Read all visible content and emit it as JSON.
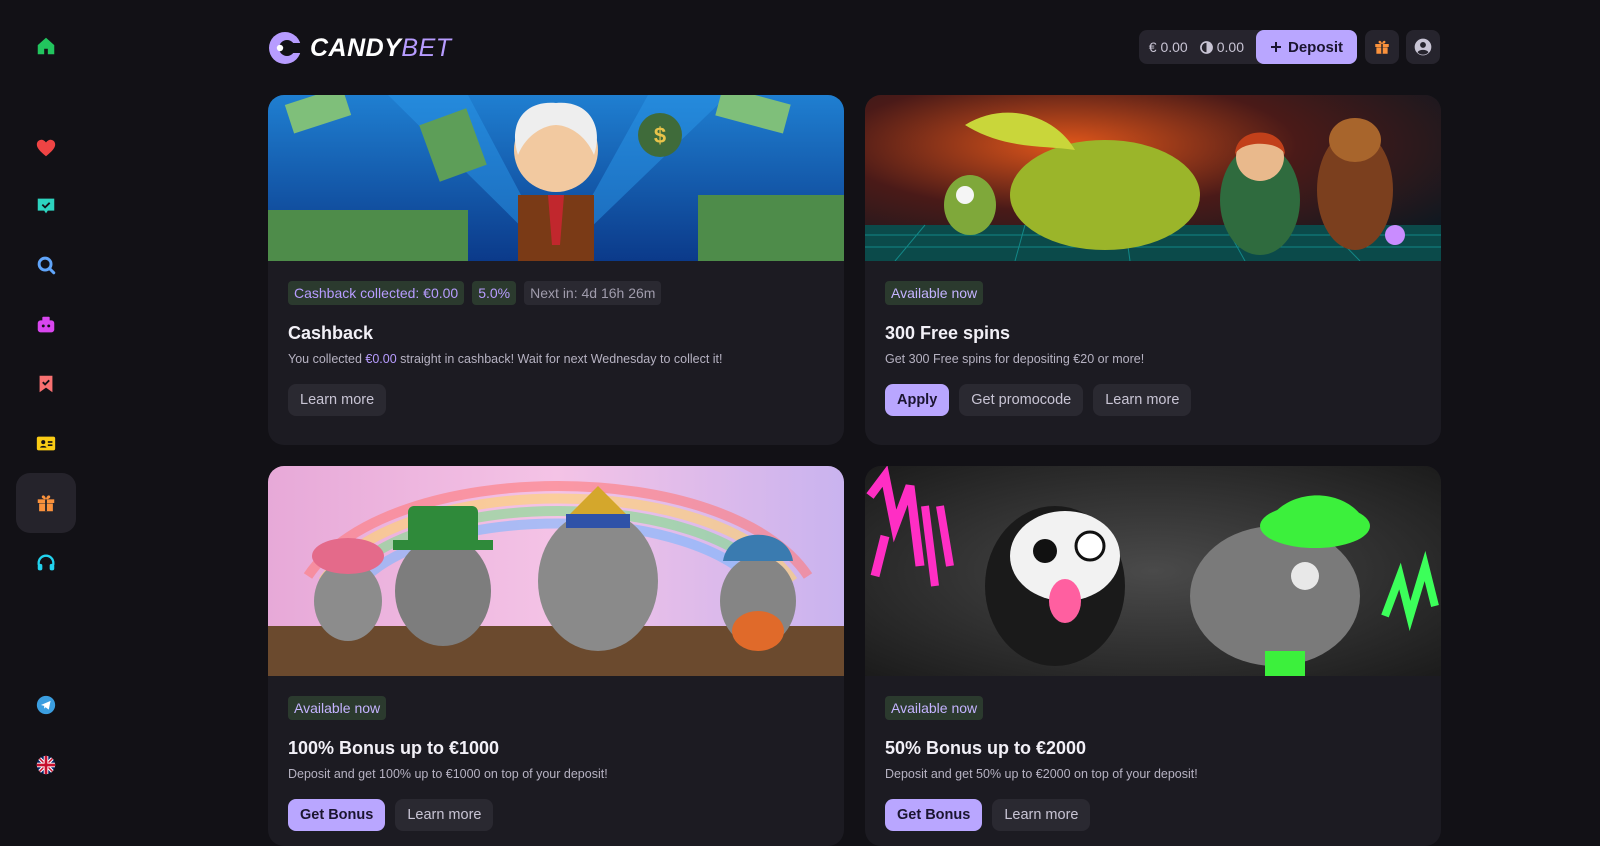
{
  "brand": {
    "name_part1": "CANDY",
    "name_part2": "BET"
  },
  "wallet": {
    "euro_balance": "€ 0.00",
    "bonus_balance": "0.00",
    "deposit_label": "Deposit"
  },
  "sidebar": {
    "items": [
      {
        "name": "home",
        "icon": "home-icon",
        "color": "#22c55e"
      },
      {
        "name": "favorites",
        "icon": "heart-icon",
        "color": "#ef4444"
      },
      {
        "name": "tasks",
        "icon": "chat-check-icon",
        "color": "#2dd4bf"
      },
      {
        "name": "search",
        "icon": "search-icon",
        "color": "#60a5fa"
      },
      {
        "name": "games",
        "icon": "gamepad-icon",
        "color": "#d946ef"
      },
      {
        "name": "bookmarks",
        "icon": "bookmark-check-icon",
        "color": "#f87171"
      },
      {
        "name": "profile-card",
        "icon": "id-card-icon",
        "color": "#facc15"
      },
      {
        "name": "promotions",
        "icon": "gift-icon",
        "color": "#fb923c"
      },
      {
        "name": "support",
        "icon": "headset-icon",
        "color": "#22d3ee"
      },
      {
        "name": "telegram",
        "icon": "telegram-icon",
        "color": "#3b9ee0"
      },
      {
        "name": "language",
        "icon": "uk-flag-icon",
        "color": "#c8102e"
      }
    ]
  },
  "promos": [
    {
      "badges": [
        "Cashback collected: €0.00",
        "5.0%",
        "Next in: 4d 16h 26m"
      ],
      "title": "Cashback",
      "desc_pre": "You collected ",
      "desc_hl": "€0.00",
      "desc_post": " straight in cashback! Wait for next Wednesday to collect it!",
      "buttons": [
        "Learn more"
      ]
    },
    {
      "badges": [
        "Available now"
      ],
      "title": "300 Free spins",
      "desc": "Get 300 Free spins for depositing €20 or more!",
      "buttons": [
        "Apply",
        "Get promocode",
        "Learn more"
      ]
    },
    {
      "badges": [
        "Available now"
      ],
      "title": "100% Bonus up to €1000",
      "desc": "Deposit and get 100% up to €1000 on top of your deposit!",
      "buttons": [
        "Get Bonus",
        "Learn more"
      ]
    },
    {
      "badges": [
        "Available now"
      ],
      "title": "50% Bonus up to €2000",
      "desc": "Deposit and get 50% up to €2000 on top of your deposit!",
      "buttons": [
        "Get Bonus",
        "Learn more"
      ]
    }
  ]
}
